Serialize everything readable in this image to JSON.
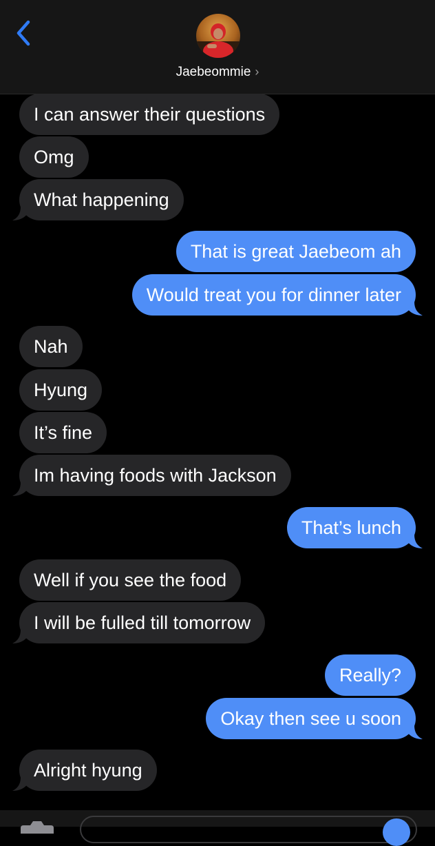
{
  "header": {
    "back_icon": "chevron-left-icon",
    "contact_name": "Jaebeommie",
    "contact_chevron": "›",
    "accent_color": "#2f7bf6"
  },
  "messages": [
    {
      "from": "them",
      "text": "I can answer their questions"
    },
    {
      "from": "them",
      "text": "Omg"
    },
    {
      "from": "them",
      "text": "What happening"
    },
    {
      "from": "me",
      "text": "That is great Jaebeom ah"
    },
    {
      "from": "me",
      "text": "Would treat you for dinner later"
    },
    {
      "from": "them",
      "text": "Nah"
    },
    {
      "from": "them",
      "text": "Hyung"
    },
    {
      "from": "them",
      "text": "It’s fine"
    },
    {
      "from": "them",
      "text": "Im having foods with Jackson"
    },
    {
      "from": "me",
      "text": "That’s lunch"
    },
    {
      "from": "them",
      "text": "Well if you see the food"
    },
    {
      "from": "them",
      "text": "I will be fulled till tomorrow"
    },
    {
      "from": "me",
      "text": "Really?"
    },
    {
      "from": "me",
      "text": "Okay then see u soon"
    },
    {
      "from": "them",
      "text": "Alright hyung"
    }
  ],
  "colors": {
    "sent_bubble": "#4f8ef7",
    "received_bubble": "#262628",
    "background": "#000000",
    "header_background": "#161616"
  },
  "input_bar": {
    "camera_icon": "camera-icon",
    "send_icon": "send-icon"
  }
}
